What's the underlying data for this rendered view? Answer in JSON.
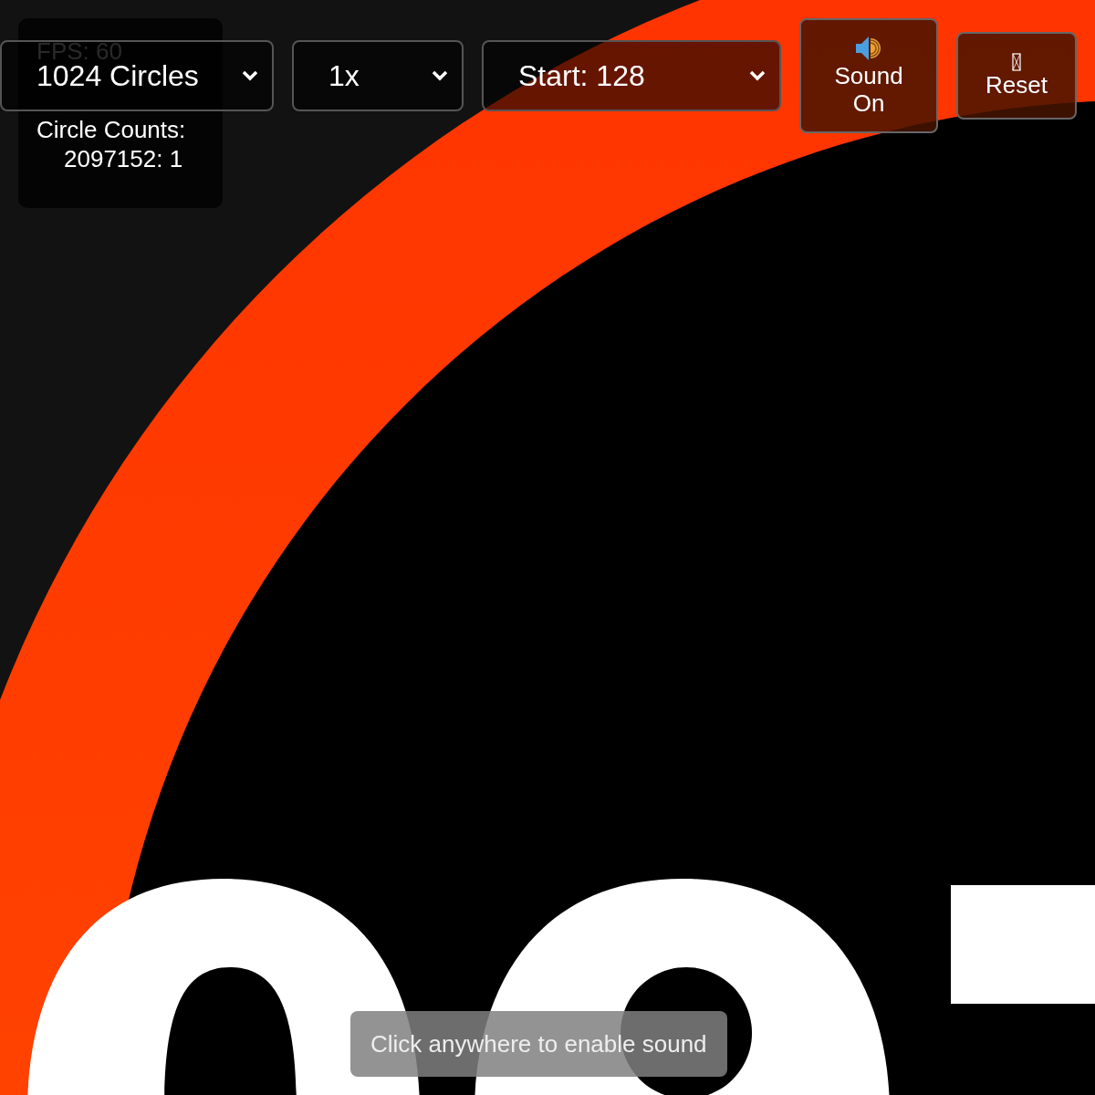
{
  "stats": {
    "fps": "FPS: 60",
    "counts_heading": "Circle Counts:",
    "counts": [
      "2097152: 1"
    ]
  },
  "dropdowns": [
    {
      "value": "1024 Circles"
    },
    {
      "value": "1x"
    },
    {
      "value": "Start: 128"
    }
  ],
  "buttons": [
    {
      "kind": "sound",
      "label": "Sound On"
    },
    {
      "kind": "reset",
      "label": "Reset"
    }
  ],
  "toast": "Click anywhere to enable sound"
}
